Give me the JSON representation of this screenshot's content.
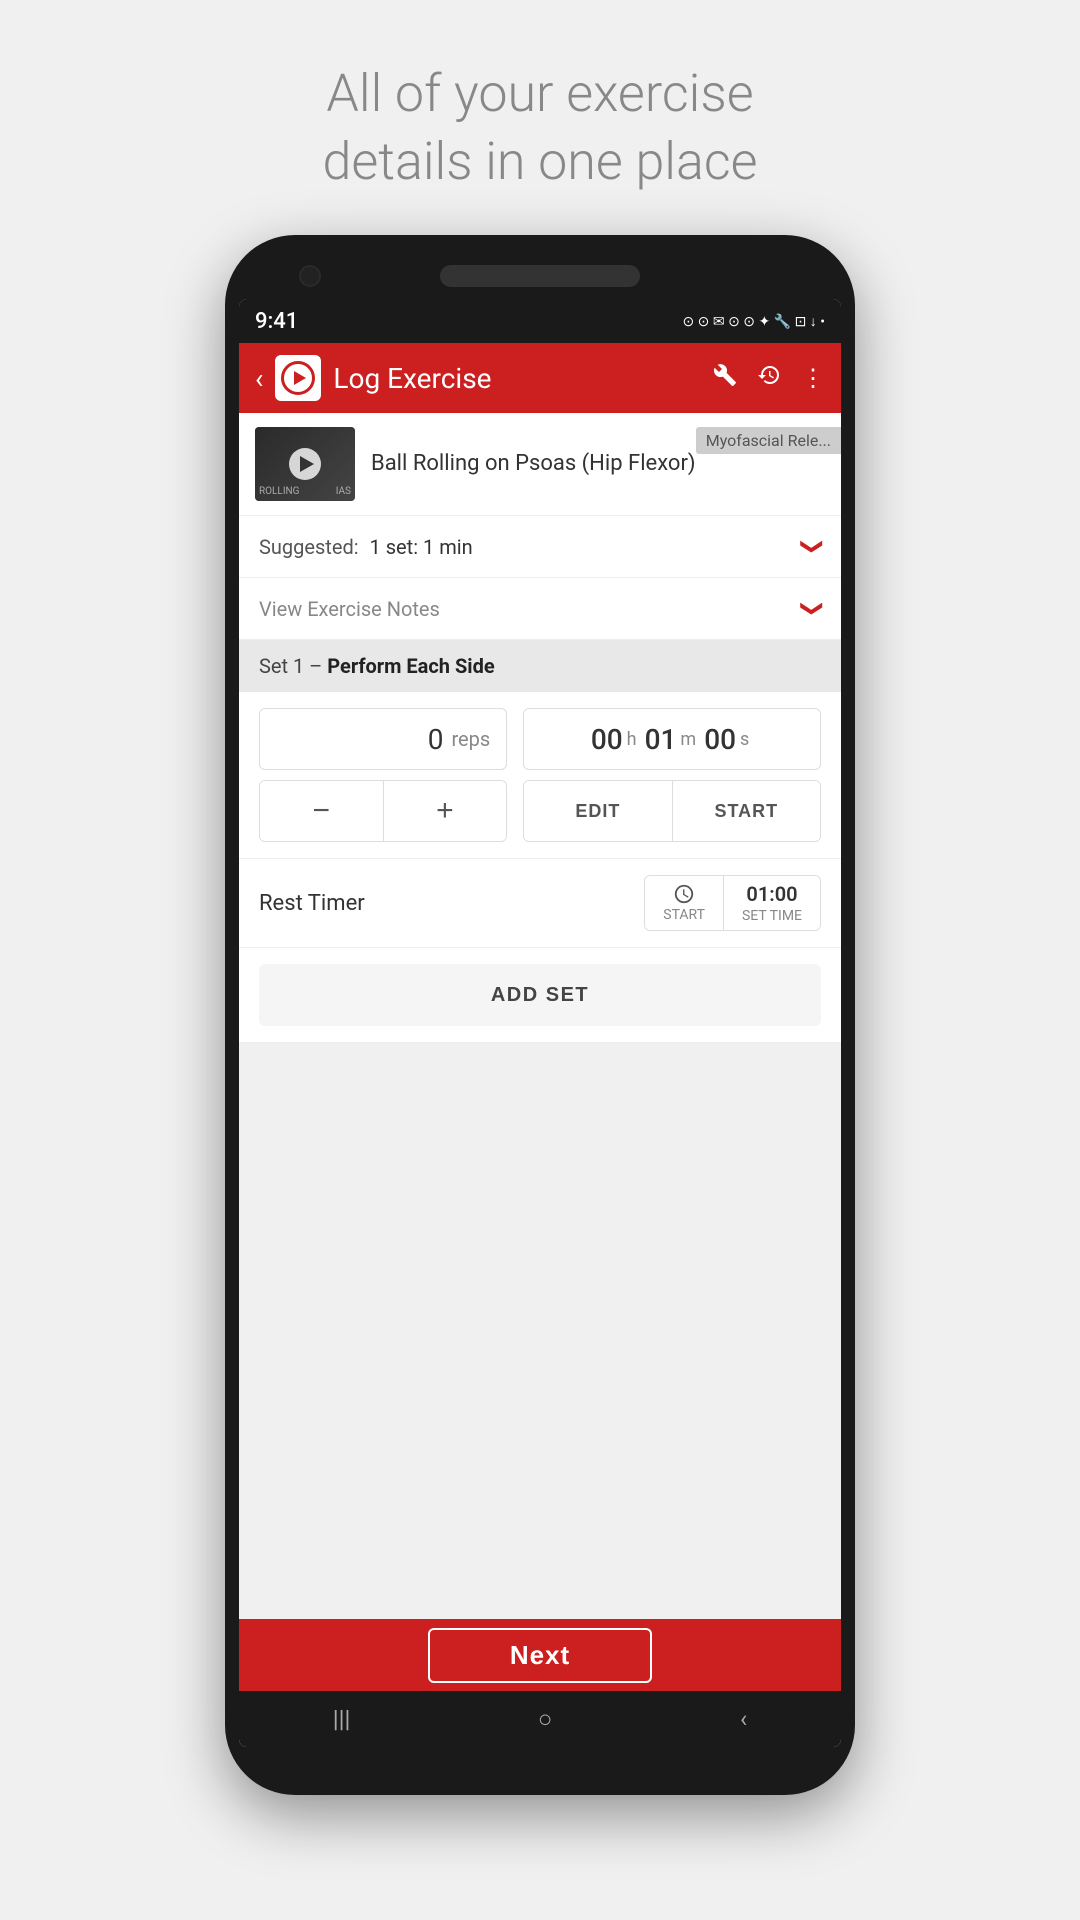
{
  "headline": {
    "line1": "All of your exercise",
    "line2": "details in one place"
  },
  "status_bar": {
    "time": "9:41",
    "icons": [
      "circle",
      "lock",
      "circle-outline",
      "envelope",
      "circle",
      "circle",
      "wrench",
      "image-icon",
      "download-icon",
      "dot"
    ]
  },
  "app_bar": {
    "back_label": "‹",
    "title": "Log Exercise",
    "action_wrench": "⚙",
    "action_history": "⏱",
    "action_more": "⋮"
  },
  "exercise": {
    "name": "Ball Rolling on Psoas (Hip Flexor)",
    "category": "Myofascial Rele...",
    "thumbnail_text": "ROLLING"
  },
  "suggested": {
    "label": "Suggested:",
    "value": "1 set: 1 min"
  },
  "view_notes": {
    "label": "View Exercise Notes"
  },
  "set": {
    "header": "Set 1 – ",
    "header_bold": "Perform Each Side",
    "reps_value": "0",
    "reps_unit": "reps",
    "timer_hours": "00",
    "timer_hours_unit": "h",
    "timer_minutes": "01",
    "timer_minutes_unit": "m",
    "timer_seconds": "00",
    "timer_seconds_unit": "s",
    "decrement_label": "−",
    "increment_label": "+",
    "edit_label": "EDIT",
    "start_label": "START"
  },
  "rest_timer": {
    "label": "Rest Timer",
    "start_label": "START",
    "set_time_value": "01:00",
    "set_time_label": "SET TIME"
  },
  "add_set": {
    "label": "ADD SET"
  },
  "next_btn": {
    "label": "Next"
  },
  "bottom_nav": {
    "menu_icon": "|||",
    "home_icon": "○",
    "back_icon": "‹"
  }
}
